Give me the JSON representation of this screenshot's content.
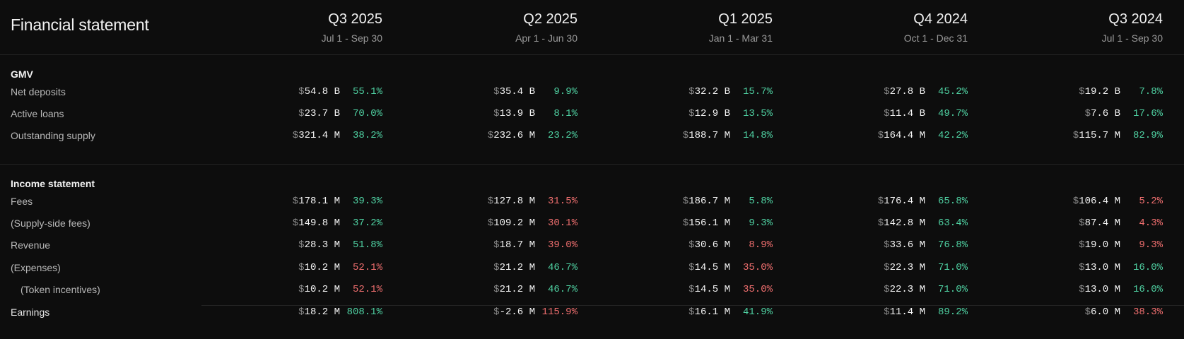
{
  "title": "Financial statement",
  "periods": [
    {
      "label": "Q3 2025",
      "range": "Jul 1 - Sep 30"
    },
    {
      "label": "Q2 2025",
      "range": "Apr 1 - Jun 30"
    },
    {
      "label": "Q1 2025",
      "range": "Jan 1 - Mar 31"
    },
    {
      "label": "Q4 2024",
      "range": "Oct 1 - Dec 31"
    },
    {
      "label": "Q3 2024",
      "range": "Jul 1 - Sep 30"
    }
  ],
  "currency_symbol": "$",
  "colors": {
    "positive": "#4fd1a2",
    "negative": "#f06f6f"
  },
  "sections": [
    {
      "title": "GMV",
      "rows": [
        {
          "label": "Net deposits",
          "cells": [
            {
              "amount": "54.8 B",
              "change": "55.1%",
              "trend": "positive"
            },
            {
              "amount": "35.4 B",
              "change": "9.9%",
              "trend": "positive"
            },
            {
              "amount": "32.2 B",
              "change": "15.7%",
              "trend": "positive"
            },
            {
              "amount": "27.8 B",
              "change": "45.2%",
              "trend": "positive"
            },
            {
              "amount": "19.2 B",
              "change": "7.8%",
              "trend": "positive"
            }
          ]
        },
        {
          "label": "Active loans",
          "cells": [
            {
              "amount": "23.7 B",
              "change": "70.0%",
              "trend": "positive"
            },
            {
              "amount": "13.9 B",
              "change": "8.1%",
              "trend": "positive"
            },
            {
              "amount": "12.9 B",
              "change": "13.5%",
              "trend": "positive"
            },
            {
              "amount": "11.4 B",
              "change": "49.7%",
              "trend": "positive"
            },
            {
              "amount": "7.6 B",
              "change": "17.6%",
              "trend": "positive"
            }
          ]
        },
        {
          "label": "Outstanding supply",
          "cells": [
            {
              "amount": "321.4 M",
              "change": "38.2%",
              "trend": "positive"
            },
            {
              "amount": "232.6 M",
              "change": "23.2%",
              "trend": "positive"
            },
            {
              "amount": "188.7 M",
              "change": "14.8%",
              "trend": "positive"
            },
            {
              "amount": "164.4 M",
              "change": "42.2%",
              "trend": "positive"
            },
            {
              "amount": "115.7 M",
              "change": "82.9%",
              "trend": "positive"
            }
          ]
        }
      ]
    },
    {
      "title": "Income statement",
      "rows": [
        {
          "label": "Fees",
          "cells": [
            {
              "amount": "178.1 M",
              "change": "39.3%",
              "trend": "positive"
            },
            {
              "amount": "127.8 M",
              "change": "31.5%",
              "trend": "negative"
            },
            {
              "amount": "186.7 M",
              "change": "5.8%",
              "trend": "positive"
            },
            {
              "amount": "176.4 M",
              "change": "65.8%",
              "trend": "positive"
            },
            {
              "amount": "106.4 M",
              "change": "5.2%",
              "trend": "negative"
            }
          ]
        },
        {
          "label": "(Supply-side fees)",
          "cells": [
            {
              "amount": "149.8 M",
              "change": "37.2%",
              "trend": "positive"
            },
            {
              "amount": "109.2 M",
              "change": "30.1%",
              "trend": "negative"
            },
            {
              "amount": "156.1 M",
              "change": "9.3%",
              "trend": "positive"
            },
            {
              "amount": "142.8 M",
              "change": "63.4%",
              "trend": "positive"
            },
            {
              "amount": "87.4 M",
              "change": "4.3%",
              "trend": "negative"
            }
          ]
        },
        {
          "label": "Revenue",
          "cells": [
            {
              "amount": "28.3 M",
              "change": "51.8%",
              "trend": "positive"
            },
            {
              "amount": "18.7 M",
              "change": "39.0%",
              "trend": "negative"
            },
            {
              "amount": "30.6 M",
              "change": "8.9%",
              "trend": "negative"
            },
            {
              "amount": "33.6 M",
              "change": "76.8%",
              "trend": "positive"
            },
            {
              "amount": "19.0 M",
              "change": "9.3%",
              "trend": "negative"
            }
          ]
        },
        {
          "label": "(Expenses)",
          "cells": [
            {
              "amount": "10.2 M",
              "change": "52.1%",
              "trend": "negative"
            },
            {
              "amount": "21.2 M",
              "change": "46.7%",
              "trend": "positive"
            },
            {
              "amount": "14.5 M",
              "change": "35.0%",
              "trend": "negative"
            },
            {
              "amount": "22.3 M",
              "change": "71.0%",
              "trend": "positive"
            },
            {
              "amount": "13.0 M",
              "change": "16.0%",
              "trend": "positive"
            }
          ]
        },
        {
          "label": "(Token incentives)",
          "cells": [
            {
              "amount": "10.2 M",
              "change": "52.1%",
              "trend": "negative"
            },
            {
              "amount": "21.2 M",
              "change": "46.7%",
              "trend": "positive"
            },
            {
              "amount": "14.5 M",
              "change": "35.0%",
              "trend": "negative"
            },
            {
              "amount": "22.3 M",
              "change": "71.0%",
              "trend": "positive"
            },
            {
              "amount": "13.0 M",
              "change": "16.0%",
              "trend": "positive"
            }
          ]
        },
        {
          "label": "Earnings",
          "cells": [
            {
              "amount": "18.2 M",
              "change": "808.1%",
              "trend": "positive"
            },
            {
              "amount": "-2.6 M",
              "change": "115.9%",
              "trend": "negative"
            },
            {
              "amount": "16.1 M",
              "change": "41.9%",
              "trend": "positive"
            },
            {
              "amount": "11.4 M",
              "change": "89.2%",
              "trend": "positive"
            },
            {
              "amount": "6.0 M",
              "change": "38.3%",
              "trend": "negative"
            }
          ]
        }
      ]
    }
  ]
}
